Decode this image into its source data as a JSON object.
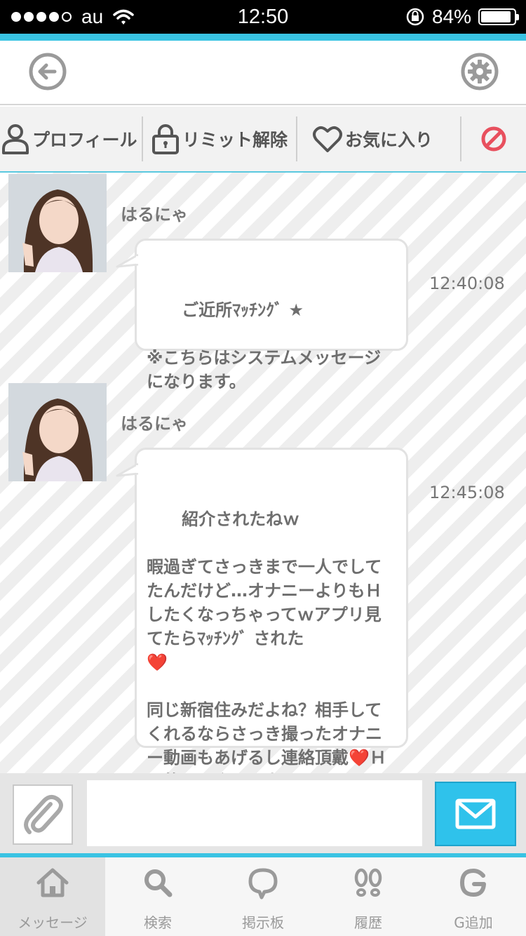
{
  "status_bar": {
    "carrier": "au",
    "time": "12:50",
    "battery": "84%",
    "battery_level": 0.84
  },
  "toolbar": {
    "profile": "プロフィール",
    "limit_release": "リミット解除",
    "favorite": "お気に入り"
  },
  "messages": [
    {
      "sender": "はるにゃ",
      "time": "12:40:08",
      "text": "ご近所ﾏｯﾁﾝｸﾞ ★\n\n※こちらはシステムメッセージになります。"
    },
    {
      "sender": "はるにゃ",
      "time": "12:45:08",
      "text_1": "紹介されたねｗ\n\n暇過ぎてさっきまで一人でしてたんだけど…オナニーよりもＨしたくなっちゃってｗアプリ見てたらﾏｯﾁﾝｸﾞ された\n",
      "heart": "❤️",
      "text_2": "\n\n同じ新宿住みだよね？相手してくれるならさっき撮ったオナニー動画もあげるし連絡頂戴",
      "text_3": "Ｈ目的でも会える人？"
    }
  ],
  "input": {
    "value": "",
    "placeholder": ""
  },
  "tabs": [
    {
      "label": "メッセージ",
      "icon": "home-icon",
      "active": true
    },
    {
      "label": "検索",
      "icon": "search-icon",
      "active": false
    },
    {
      "label": "掲示板",
      "icon": "speech-bubble-icon",
      "active": false
    },
    {
      "label": "履歴",
      "icon": "footprints-icon",
      "active": false
    },
    {
      "label": "G追加",
      "icon": "g-icon",
      "active": false
    }
  ],
  "colors": {
    "accent": "#39c3e3",
    "send_button": "#2fc2eb",
    "block_icon": "#e8505e",
    "heart": "#e0242e"
  }
}
